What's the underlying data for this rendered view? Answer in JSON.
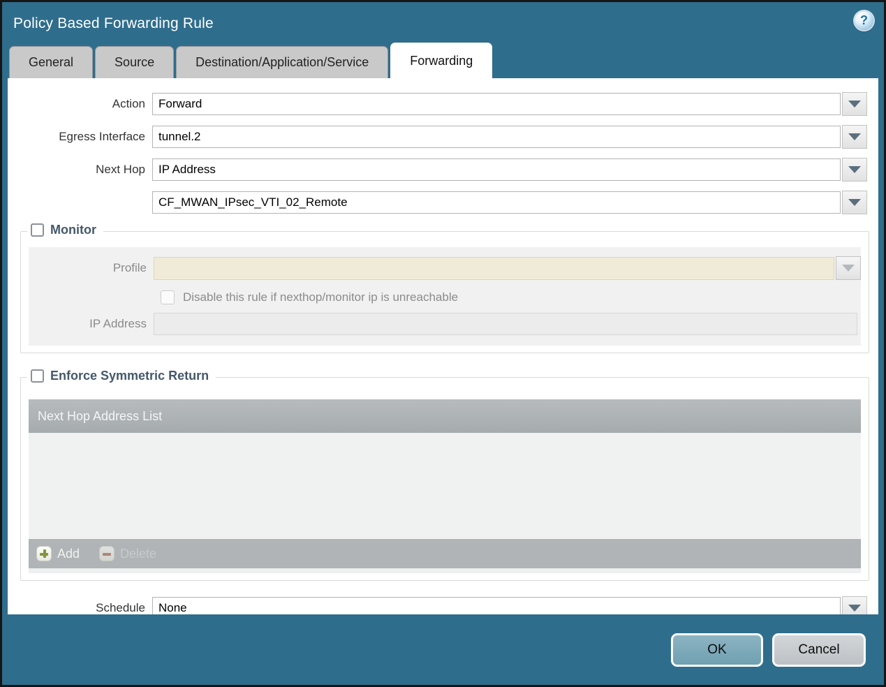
{
  "window": {
    "title": "Policy Based Forwarding Rule"
  },
  "tabs": [
    {
      "label": "General",
      "active": false
    },
    {
      "label": "Source",
      "active": false
    },
    {
      "label": "Destination/Application/Service",
      "active": false
    },
    {
      "label": "Forwarding",
      "active": true
    }
  ],
  "form": {
    "action": {
      "label": "Action",
      "value": "Forward"
    },
    "egress_interface": {
      "label": "Egress Interface",
      "value": "tunnel.2"
    },
    "next_hop": {
      "label": "Next Hop",
      "value": "IP Address"
    },
    "next_hop_address": {
      "value": "CF_MWAN_IPsec_VTI_02_Remote"
    },
    "schedule": {
      "label": "Schedule",
      "value": "None"
    }
  },
  "monitor": {
    "legend": "Monitor",
    "checked": false,
    "profile": {
      "label": "Profile",
      "value": ""
    },
    "disable_rule_label": "Disable this rule if nexthop/monitor ip is unreachable",
    "disable_rule_checked": false,
    "ip_address": {
      "label": "IP Address",
      "value": ""
    }
  },
  "symmetric_return": {
    "legend": "Enforce Symmetric Return",
    "checked": false,
    "table": {
      "header": "Next Hop Address List",
      "rows": []
    },
    "add_label": "Add",
    "delete_label": "Delete",
    "delete_enabled": false
  },
  "footer": {
    "ok_label": "OK",
    "cancel_label": "Cancel"
  },
  "colors": {
    "chrome_teal": "#2f6d8c",
    "inactive_tab": "#c9c9c9",
    "legend_text": "#44586c",
    "table_header": "#a9aeb1",
    "table_footer_bar": "#b0b4b6",
    "disabled_profile_field": "#f0ead8",
    "add_plus_green": "#84953b",
    "delete_minus_red": "#b07a68",
    "ok_button": "#7aa7b8",
    "cancel_button": "#c6c9cc"
  }
}
